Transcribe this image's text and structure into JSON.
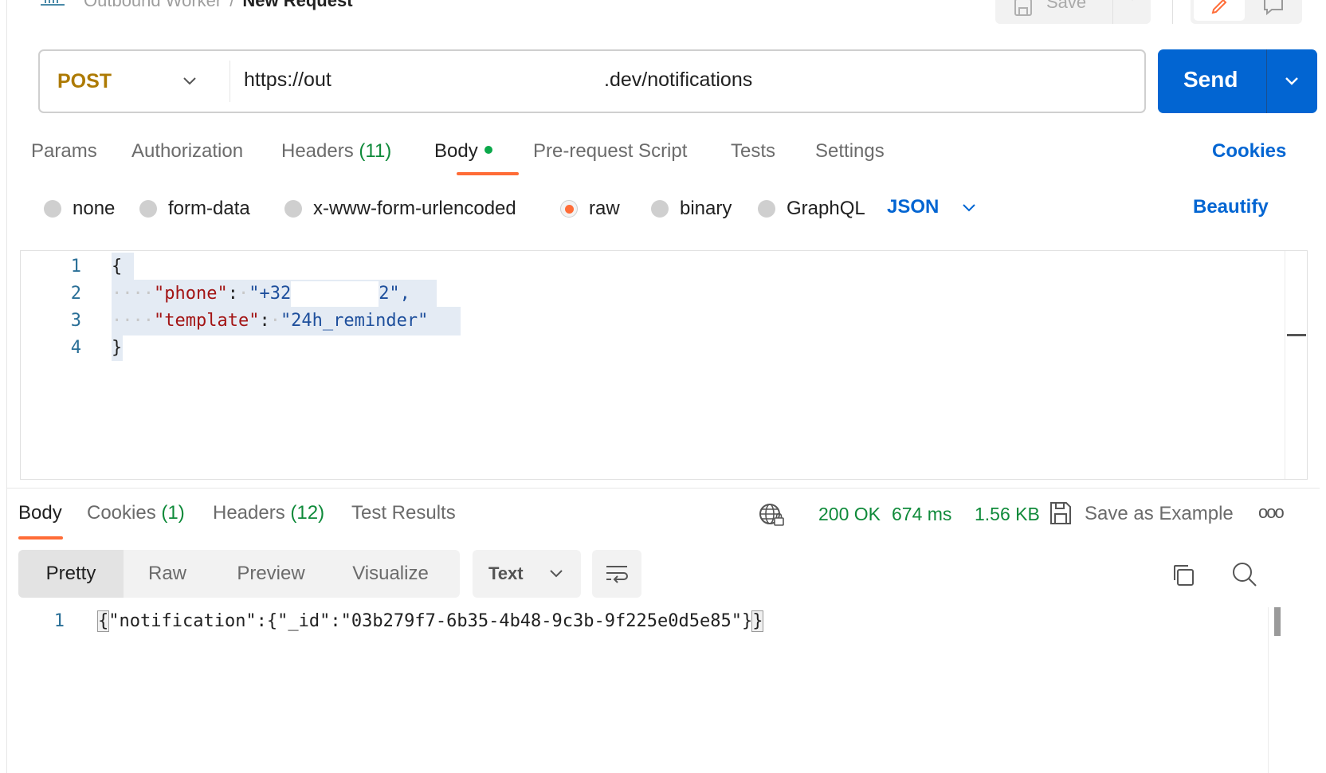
{
  "breadcrumb": {
    "collection": "Outbound Worker",
    "separator": "/",
    "current": "New Request"
  },
  "toolbar": {
    "save_label": "Save"
  },
  "request": {
    "method": "POST",
    "url_visible_start": "https://out",
    "url_visible_end": ".dev/notifications",
    "send_label": "Send"
  },
  "request_tabs": {
    "params": "Params",
    "authorization": "Authorization",
    "headers": "Headers",
    "headers_count": "(11)",
    "body": "Body",
    "pre_request": "Pre-request Script",
    "tests": "Tests",
    "settings": "Settings",
    "cookies": "Cookies"
  },
  "body_types": {
    "none": "none",
    "form_data": "form-data",
    "urlencoded": "x-www-form-urlencoded",
    "raw": "raw",
    "binary": "binary",
    "graphql": "GraphQL",
    "language": "JSON",
    "beautify": "Beautify",
    "selected": "raw"
  },
  "editor": {
    "line_numbers": [
      "1",
      "2",
      "3",
      "4"
    ],
    "open_brace": "{",
    "close_brace": "}",
    "key_phone": "\"phone\"",
    "val_phone_start": "\"+32",
    "val_phone_end": "2\",",
    "key_template": "\"template\"",
    "val_template": "\"24h_reminder\"",
    "colon": ":"
  },
  "response": {
    "tabs": {
      "body": "Body",
      "cookies": "Cookies",
      "cookies_count": "(1)",
      "headers": "Headers",
      "headers_count": "(12)",
      "test_results": "Test Results"
    },
    "status": "200 OK",
    "time": "674 ms",
    "size": "1.56 KB",
    "save_example": "Save as Example",
    "more": "ooo",
    "views": [
      "Pretty",
      "Raw",
      "Preview",
      "Visualize"
    ],
    "active_view": "Pretty",
    "format": "Text",
    "line_number": "1",
    "body_open": "{",
    "body_middle": "\"notification\":{\"_id\":\"03b279f7-6b35-4b48-9c3b-9f225e0d5e85\"}",
    "body_close": "}"
  },
  "colors": {
    "accent_orange": "#ff6c37",
    "send_blue": "#0265d2",
    "method_post": "#ad7a03",
    "success_green": "#0f8a3a",
    "json_key": "#a31515",
    "json_string": "#1e4f9c"
  }
}
